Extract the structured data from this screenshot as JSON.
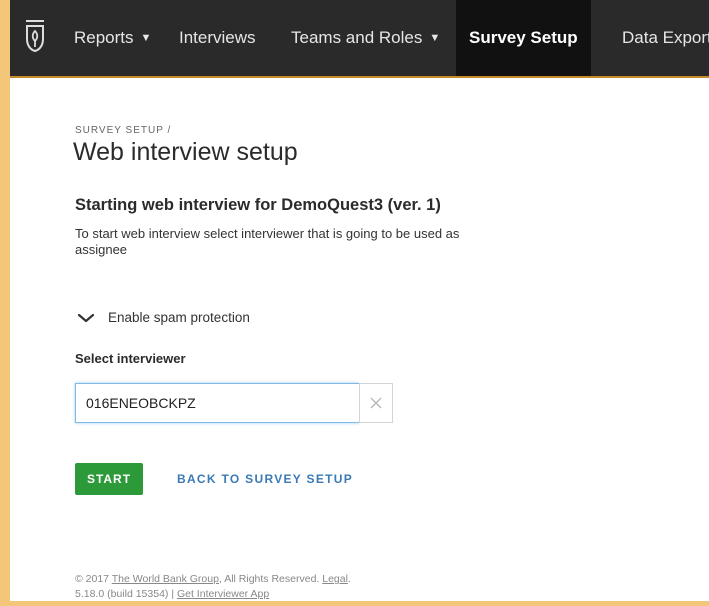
{
  "navbar": {
    "items": [
      {
        "label": "Reports",
        "has_dropdown": true,
        "active": false
      },
      {
        "label": "Interviews",
        "has_dropdown": false,
        "active": false
      },
      {
        "label": "Teams and Roles",
        "has_dropdown": true,
        "active": false
      },
      {
        "label": "Survey Setup",
        "has_dropdown": false,
        "active": true
      },
      {
        "label": "Data Export",
        "has_dropdown": false,
        "active": false
      }
    ],
    "caret": "▼"
  },
  "breadcrumb": "SURVEY SETUP  /",
  "page_title": "Web interview setup",
  "subtitle": "Starting web interview for DemoQuest3 (ver. 1)",
  "description": "To start web interview select interviewer that is going to be used as assignee",
  "spam_protection": {
    "label": "Enable spam protection",
    "icon": "chevron-down-icon"
  },
  "interviewer": {
    "label": "Select interviewer",
    "value": "016ENEOBCKPZ",
    "clear_icon": "close-icon"
  },
  "buttons": {
    "start": "START",
    "back": "BACK TO SURVEY SETUP"
  },
  "footer": {
    "copyright_prefix": "© 2017 ",
    "org": "The World Bank Group",
    "rights": ", All Rights Reserved. ",
    "legal": "Legal",
    "legal_suffix": ".",
    "version": "5.18.0 (build 15354) | ",
    "app_link": "Get Interviewer App"
  },
  "colors": {
    "navbar": "#2a2a2a",
    "active_nav": "#111111",
    "start": "#2d9a3a",
    "link": "#3a7ab5",
    "frame": "#f4c679"
  }
}
